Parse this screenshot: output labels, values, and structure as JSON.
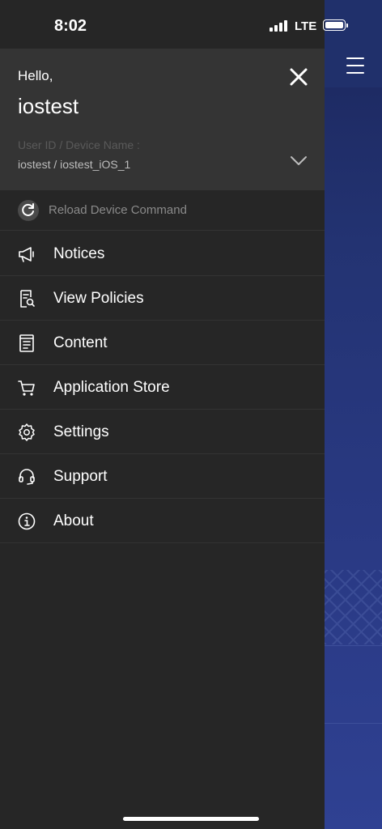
{
  "status_bar": {
    "time": "8:02",
    "network": "LTE"
  },
  "drawer": {
    "greeting": "Hello,",
    "username": "iostest",
    "device_label": "User ID / Device Name :",
    "device_value": "iostest / iostest_iOS_1",
    "reload_label": "Reload Device Command",
    "menu": [
      {
        "label": "Notices",
        "icon": "megaphone-icon"
      },
      {
        "label": "View Policies",
        "icon": "policy-search-icon"
      },
      {
        "label": "Content",
        "icon": "document-icon"
      },
      {
        "label": "Application Store",
        "icon": "cart-icon"
      },
      {
        "label": "Settings",
        "icon": "gear-icon"
      },
      {
        "label": "Support",
        "icon": "headset-icon"
      },
      {
        "label": "About",
        "icon": "info-icon"
      }
    ]
  },
  "colors": {
    "drawer_bg": "#262626",
    "header_bg": "#343434",
    "right_pane": "#233372"
  }
}
